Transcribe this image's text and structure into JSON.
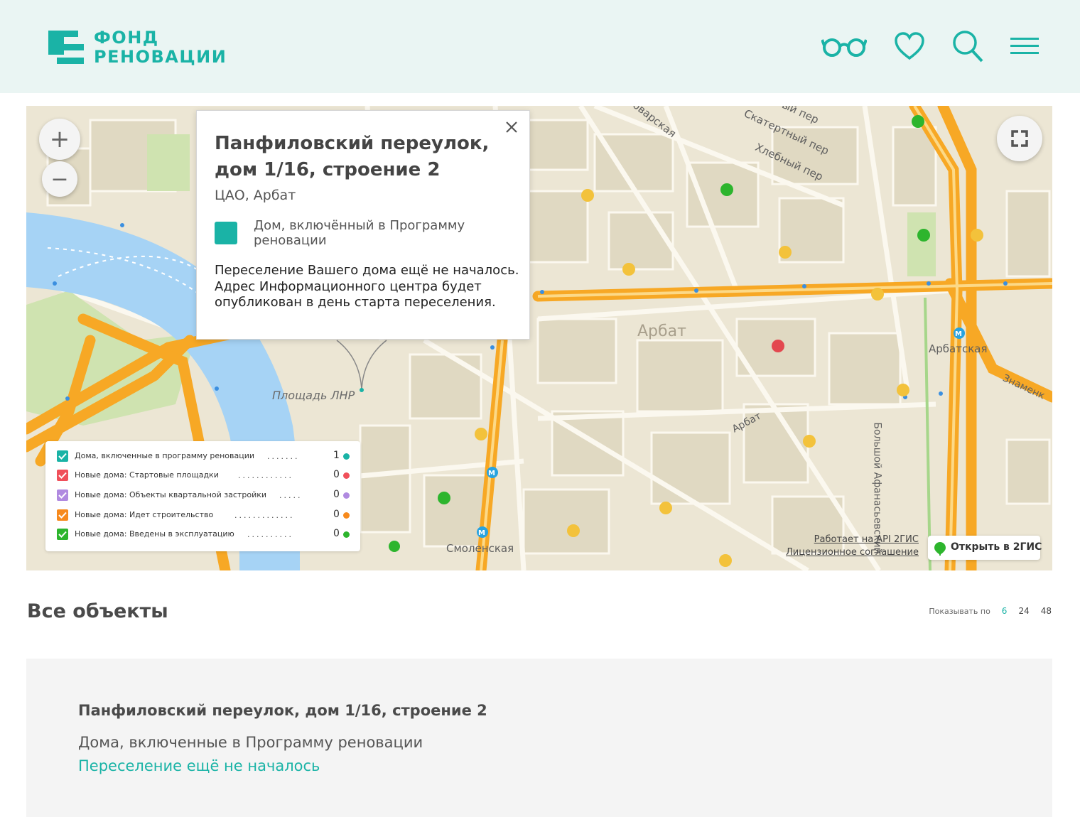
{
  "header": {
    "logo_line1": "ФОНД",
    "logo_line2": "РЕНОВАЦИИ",
    "icons": [
      "glasses-icon",
      "heart-icon",
      "search-icon",
      "menu-icon"
    ],
    "accent_color": "#1ab3a6"
  },
  "map": {
    "zoom_in": "+",
    "zoom_out": "−",
    "labels": {
      "district": "Арбат",
      "square": "Площадь ЛНР",
      "metro_arbatskaya": "Арбатская",
      "metro_smolenskaya": "Смоленская",
      "street_arbat": "Арбат",
      "street_znamenka": "Знаменк",
      "street_skatertny": "Скатертный пер",
      "street_khlebny": "Хлебный пер",
      "street_povarskaya": "оварская",
      "street_top": "ый пер",
      "street_afanasyevsky": "Большой Афанасьевский"
    },
    "attribution_api": "Работает на API 2ГИС",
    "attribution_license": "Лицензионное соглашение",
    "open_button": "Открыть в 2ГИС"
  },
  "popup": {
    "title": "Панфиловский переулок, дом 1/16, строение 2",
    "district": "ЦАО, Арбат",
    "status": "Дом, включённый в Программу реновации",
    "description": "Переселение Вашего дома ещё не началось. Адрес Информационного центра будет опубликован в день старта переселения.",
    "status_color": "#1ab3a6"
  },
  "legend": [
    {
      "label": "Дома, включенные в программу реновации",
      "count": "1",
      "color": "#1ab3a6"
    },
    {
      "label": "Новые дома: Стартовые площадки",
      "count": "0",
      "color": "#f0505a"
    },
    {
      "label": "Новые дома: Объекты квартальной застройки",
      "count": "0",
      "color": "#b08ae0"
    },
    {
      "label": "Новые дома: Идет строительство",
      "count": "0",
      "color": "#f78a1d"
    },
    {
      "label": "Новые дома: Введены в эксплуатацию",
      "count": "0",
      "color": "#2db52d"
    }
  ],
  "listing": {
    "title": "Все объекты",
    "per_page_label": "Показывать по",
    "per_page_options": [
      "6",
      "24",
      "48"
    ],
    "per_page_selected": "6"
  },
  "card": {
    "title": "Панфиловский переулок, дом 1/16, строение 2",
    "type": "Дома, включенные в Программу реновации",
    "status": "Переселение ещё не началось"
  }
}
